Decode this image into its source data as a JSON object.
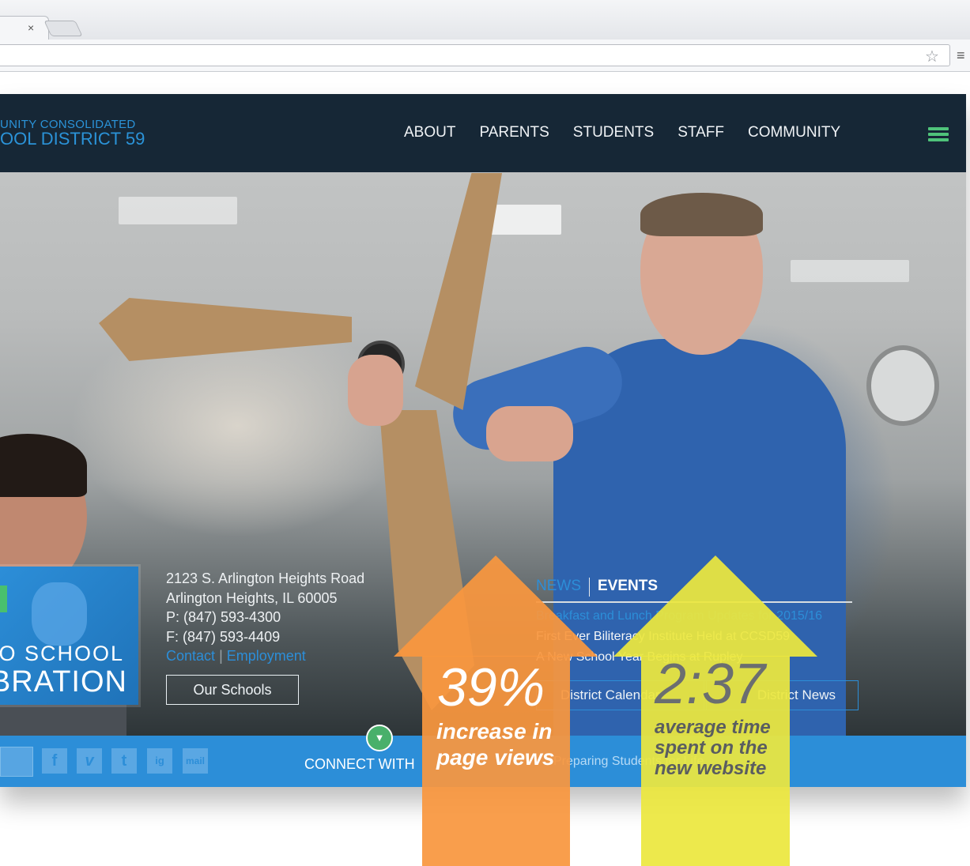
{
  "browser": {
    "close_glyph": "×",
    "star_glyph": "☆",
    "menu_glyph": "≡"
  },
  "header": {
    "logo_line1": "UNITY CONSOLIDATED",
    "logo_line2": "OOL DISTRICT 59",
    "nav": [
      "ABOUT",
      "PARENTS",
      "STUDENTS",
      "STAFF",
      "COMMUNITY"
    ]
  },
  "promo": {
    "line1": "O SCHOOL",
    "line2": "BRATION"
  },
  "contact": {
    "address1": "2123 S. Arlington Heights Road",
    "address2": "Arlington Heights, IL 60005",
    "phone": "P: (847) 593-4300",
    "fax": "F: (847) 593-4409",
    "contact_link": "Contact",
    "separator": "|",
    "employment_link": "Employment",
    "schools_button": "Our Schools"
  },
  "news": {
    "tab_news": "NEWS",
    "tab_events": "EVENTS",
    "items": [
      "Breakfast and Lunch Program Updates for 2015/16",
      "First Ever Biliteracy Institute Held at CCSD59",
      "A New School Year Begins at Rupley"
    ],
    "calendar_button": "District Calendar",
    "news_button": "District News"
  },
  "footer": {
    "social": [
      "f",
      "v",
      "t",
      "ig",
      "mail"
    ],
    "connect_label": "CONNECT WITH",
    "toggle_glyph": "▼",
    "tagline": "Preparing Students for Life"
  },
  "stats": [
    {
      "value": "39%",
      "label_lines": [
        "increase in",
        "page views"
      ],
      "color": "#f9973e"
    },
    {
      "value": "2:37",
      "label_lines": [
        "average time",
        "spent on the",
        "new website"
      ],
      "color": "#ece73e"
    }
  ],
  "colors": {
    "brand_blue": "#2c8ed8",
    "header_bg": "#0f2030",
    "menu_green": "#4fc37a"
  }
}
